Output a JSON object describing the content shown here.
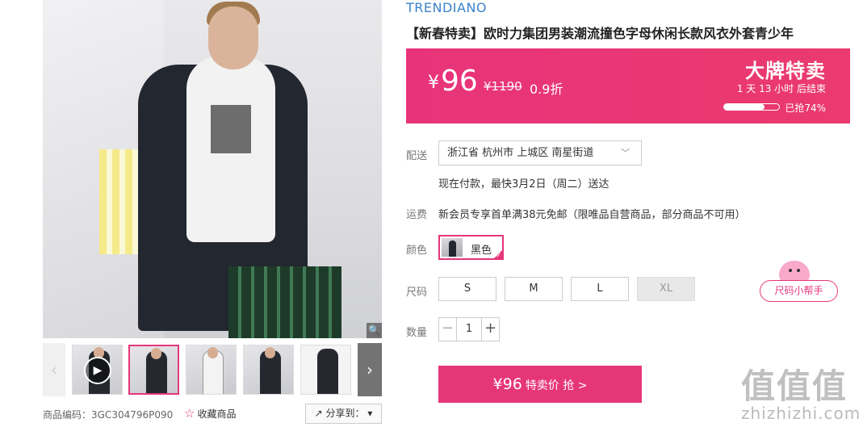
{
  "product": {
    "brand": "TRENDIANO",
    "title": "【新春特卖】欧时力集团男装潮流撞色字母休闲长款风衣外套青少年"
  },
  "price_band": {
    "currency": "¥",
    "price": "96",
    "original_price": "¥1190",
    "discount": "0.9折",
    "tag": "大牌特卖",
    "countdown": "1 天 13 小时 后结束",
    "sold_text": "已抢74%",
    "sold_fraction": 0.74,
    "accent_color": "#e8337a"
  },
  "shipping": {
    "label": "配送",
    "location": "浙江省 杭州市 上城区 南星街道",
    "eta": "现在付款，最快3月2日（周二）送达"
  },
  "freight": {
    "label": "运费",
    "text": "新会员专享首单满38元免邮（限唯品自营商品，部分商品不可用）"
  },
  "color": {
    "label": "颜色",
    "selected": "黑色"
  },
  "size": {
    "label": "尺码",
    "options": [
      "S",
      "M",
      "L",
      "XL"
    ],
    "disabled": [
      "XL"
    ],
    "helper": "尺码小帮手"
  },
  "quantity": {
    "label": "数量",
    "value": "1",
    "minus": "−",
    "plus": "+"
  },
  "buy": {
    "price": "¥96",
    "label": "特卖价 抢 >"
  },
  "gallery": {
    "prev": "‹",
    "next": "›",
    "zoom": "🔍",
    "play": "▶"
  },
  "meta": {
    "sku": "商品编码：3GC304796P090",
    "favorite": "收藏商品",
    "share": "分享到："
  },
  "watermark": {
    "logo": "值值值",
    "url": "zhizhizhi.com"
  }
}
